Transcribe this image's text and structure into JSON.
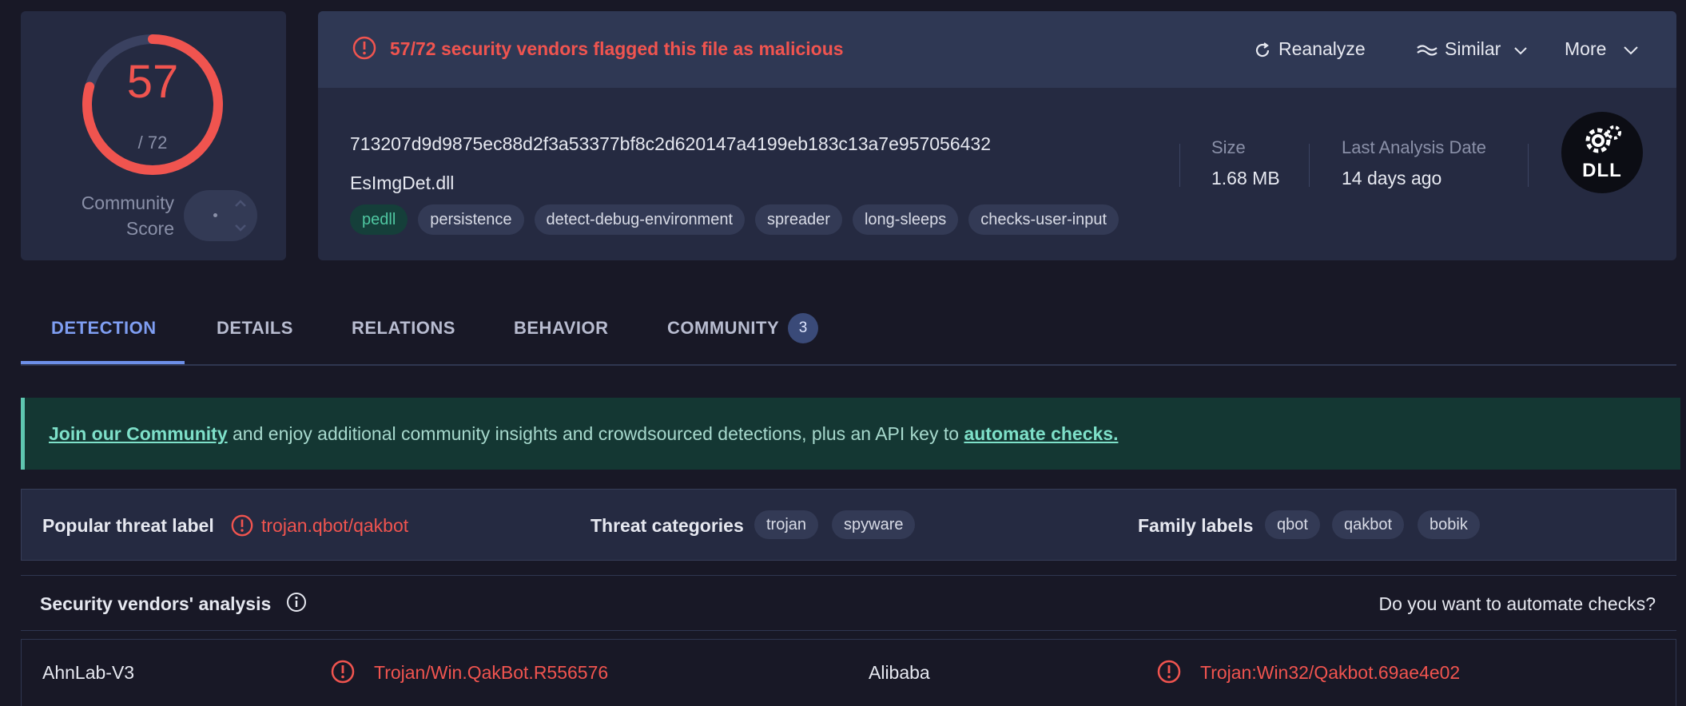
{
  "score": {
    "detections": "57",
    "total": "/ 72",
    "community_label": "Community Score",
    "vote_value": "-"
  },
  "header": {
    "alert": "57/72 security vendors flagged this file as malicious",
    "actions": {
      "reanalyze": "Reanalyze",
      "similar": "Similar",
      "more": "More"
    },
    "hash": "713207d9d9875ec88d2f3a53377bf8c2d620147a4199eb183c13a7e957056432",
    "filename": "EsImgDet.dll",
    "tags": [
      "pedll",
      "persistence",
      "detect-debug-environment",
      "spreader",
      "long-sleeps",
      "checks-user-input"
    ],
    "size_label": "Size",
    "size_value": "1.68 MB",
    "date_label": "Last Analysis Date",
    "date_value": "14 days ago",
    "filetype_icon_text": "DLL"
  },
  "tabs": {
    "detection": "DETECTION",
    "details": "DETAILS",
    "relations": "RELATIONS",
    "behavior": "BEHAVIOR",
    "community": "COMMUNITY",
    "community_count": "3"
  },
  "banner": {
    "join_link": "Join our Community",
    "middle": " and enjoy additional community insights and crowdsourced detections, plus an API key to ",
    "automate_link": "automate checks."
  },
  "threat": {
    "popular_label": "Popular threat label",
    "popular_value": "trojan.qbot/qakbot",
    "categories_label": "Threat categories",
    "categories": [
      "trojan",
      "spyware"
    ],
    "family_label": "Family labels",
    "families": [
      "qbot",
      "qakbot",
      "bobik"
    ]
  },
  "vendors": {
    "title": "Security vendors' analysis",
    "automate_prompt": "Do you want to automate checks?",
    "rows": [
      {
        "left_vendor": "AhnLab-V3",
        "left_result": "Trojan/Win.QakBot.R556576",
        "right_vendor": "Alibaba",
        "right_result": "Trojan:Win32/Qakbot.69ae4e02"
      }
    ]
  },
  "colors": {
    "malicious": "#f0544f",
    "accent": "#7f9ef2",
    "banner_bg": "#143733"
  },
  "icons": [
    "alert-circle-icon",
    "refresh-icon",
    "similar-icon",
    "chevron-down-icon",
    "info-icon",
    "dll-file-icon",
    "chevron-up-icon"
  ]
}
